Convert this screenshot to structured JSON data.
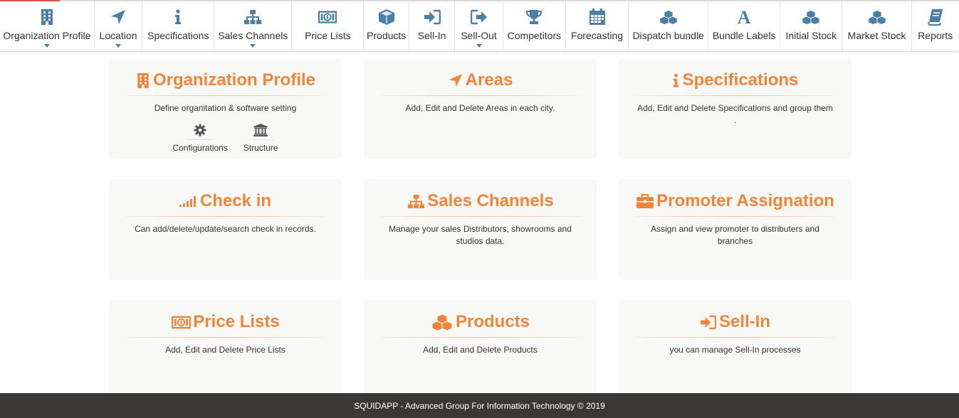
{
  "colors": {
    "accent": "#f0853a",
    "nav_icon": "#4a7fa6",
    "footer_bg": "#3a3836"
  },
  "nav": [
    {
      "label": "Organization Profile",
      "icon": "building-icon",
      "has_caret": true
    },
    {
      "label": "Location",
      "icon": "location-arrow-icon",
      "has_caret": true
    },
    {
      "label": "Specifications",
      "icon": "info-icon",
      "has_caret": false
    },
    {
      "label": "Sales Channels",
      "icon": "sitemap-icon",
      "has_caret": true
    },
    {
      "label": "Price Lists",
      "icon": "money-icon",
      "has_caret": false
    },
    {
      "label": "Products",
      "icon": "cube-icon",
      "has_caret": false
    },
    {
      "label": "Sell-In",
      "icon": "sign-in-icon",
      "has_caret": false
    },
    {
      "label": "Sell-Out",
      "icon": "sign-out-icon",
      "has_caret": true
    },
    {
      "label": "Competitors",
      "icon": "trophy-icon",
      "has_caret": false
    },
    {
      "label": "Forecasting",
      "icon": "calendar-icon",
      "has_caret": false
    },
    {
      "label": "Dispatch bundle",
      "icon": "cubes-icon",
      "has_caret": false
    },
    {
      "label": "Bundle Labels",
      "icon": "font-icon",
      "has_caret": false
    },
    {
      "label": "Initial Stock",
      "icon": "cubes-icon",
      "has_caret": false
    },
    {
      "label": "Market Stock",
      "icon": "cubes-icon",
      "has_caret": false
    },
    {
      "label": "Reports",
      "icon": "book-icon",
      "has_caret": false
    }
  ],
  "cards": [
    {
      "title": "Organization Profile",
      "icon": "building-icon",
      "description": "Define organitation & software setting",
      "subs": [
        {
          "label": "Configurations",
          "icon": "gear-icon"
        },
        {
          "label": "Structure",
          "icon": "bank-icon"
        }
      ]
    },
    {
      "title": "Areas",
      "icon": "location-arrow-icon",
      "description": "Add, Edit and Delete Areas in each city."
    },
    {
      "title": "Specifications",
      "icon": "info-icon",
      "description": "Add, Edit and Delete Specifications and group them ."
    },
    {
      "title": "Check in",
      "icon": "signal-icon",
      "description": "Can add/delete/update/search check in records."
    },
    {
      "title": "Sales Channels",
      "icon": "sitemap-icon",
      "description": "Manage your sales Distributors, showrooms and studios data."
    },
    {
      "title": "Promoter Assignation",
      "icon": "briefcase-icon",
      "description": "Assign and view promoter to distributers and branches"
    },
    {
      "title": "Price Lists",
      "icon": "money-icon",
      "description": "Add, Edit and Delete Price Lists"
    },
    {
      "title": "Products",
      "icon": "cubes-icon",
      "description": "Add, Edit and Delete Products"
    },
    {
      "title": "Sell-In",
      "icon": "sign-in-icon",
      "description": "you can manage Sell-In processes"
    }
  ],
  "footer": {
    "text": "SQUIDAPP - Advanced Group For Information Technology © 2019"
  }
}
